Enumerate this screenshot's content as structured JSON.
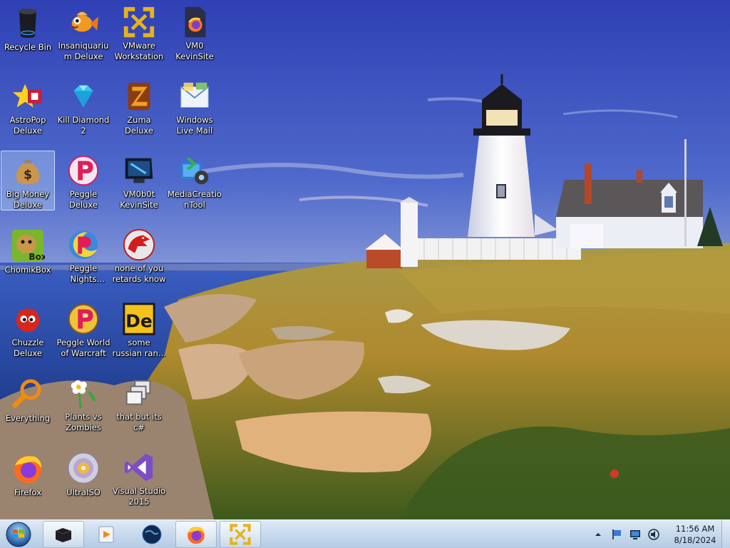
{
  "desktop": {
    "icons": [
      {
        "label": "Recycle Bin",
        "icon": "recycle-bin-icon"
      },
      {
        "label": "Insaniquarium Deluxe",
        "icon": "goldfish-icon"
      },
      {
        "label": "VMware Workstation",
        "icon": "vmware-icon"
      },
      {
        "label": "VM0 KevinSite",
        "icon": "firefox-file-icon"
      },
      {
        "label": "AstroPop Deluxe",
        "icon": "astropop-icon"
      },
      {
        "label": "Kill Diamond 2",
        "icon": "diamond-icon"
      },
      {
        "label": "Zuma Deluxe",
        "icon": "zuma-icon"
      },
      {
        "label": "Windows Live Mail",
        "icon": "live-mail-icon"
      },
      {
        "label": "Big Money Deluxe",
        "icon": "money-bag-icon"
      },
      {
        "label": "Peggle Deluxe",
        "icon": "peggle-icon"
      },
      {
        "label": "VM0b0t KevinSite",
        "icon": "terminal-icon"
      },
      {
        "label": "MediaCreationTool",
        "icon": "media-creation-icon"
      },
      {
        "label": "ChomikBox",
        "icon": "chomikbox-icon"
      },
      {
        "label": "Peggle Nights Deluxe",
        "icon": "peggle-nights-icon"
      },
      {
        "label": "none of you retards know",
        "icon": "red-dragon-icon"
      },
      {
        "label": "Chuzzle Deluxe",
        "icon": "chuzzle-icon"
      },
      {
        "label": "Peggle World of Warcraft",
        "icon": "peggle-wow-icon"
      },
      {
        "label": "some russian ran a rat",
        "icon": "de-icon"
      },
      {
        "label": "Everything",
        "icon": "magnifier-icon"
      },
      {
        "label": "Plants vs Zombies",
        "icon": "flower-icon"
      },
      {
        "label": "that but its c#",
        "icon": "windows-stack-icon"
      },
      {
        "label": "Firefox",
        "icon": "firefox-icon"
      },
      {
        "label": "UltraISO",
        "icon": "disc-icon"
      },
      {
        "label": "Visual Studio 2015",
        "icon": "visual-studio-icon"
      }
    ]
  },
  "taskbar": {
    "pinned": [
      {
        "icon": "dark-box-icon",
        "open": true
      },
      {
        "icon": "media-player-icon",
        "open": false
      },
      {
        "icon": "globe-icon",
        "open": false
      },
      {
        "icon": "firefox-icon",
        "open": true
      },
      {
        "icon": "vmware-icon",
        "open": true
      }
    ],
    "tray_icons": [
      "chevron-up-icon",
      "flag-icon",
      "monitor-icon",
      "volume-icon"
    ],
    "clock": {
      "time": "11:56 AM",
      "date": "8/18/2024"
    }
  },
  "colors": {
    "sky_top": "#3346b8",
    "sea": "#2f4fb0",
    "grass": "#a7952c",
    "taskbar": "#c9dbee"
  }
}
